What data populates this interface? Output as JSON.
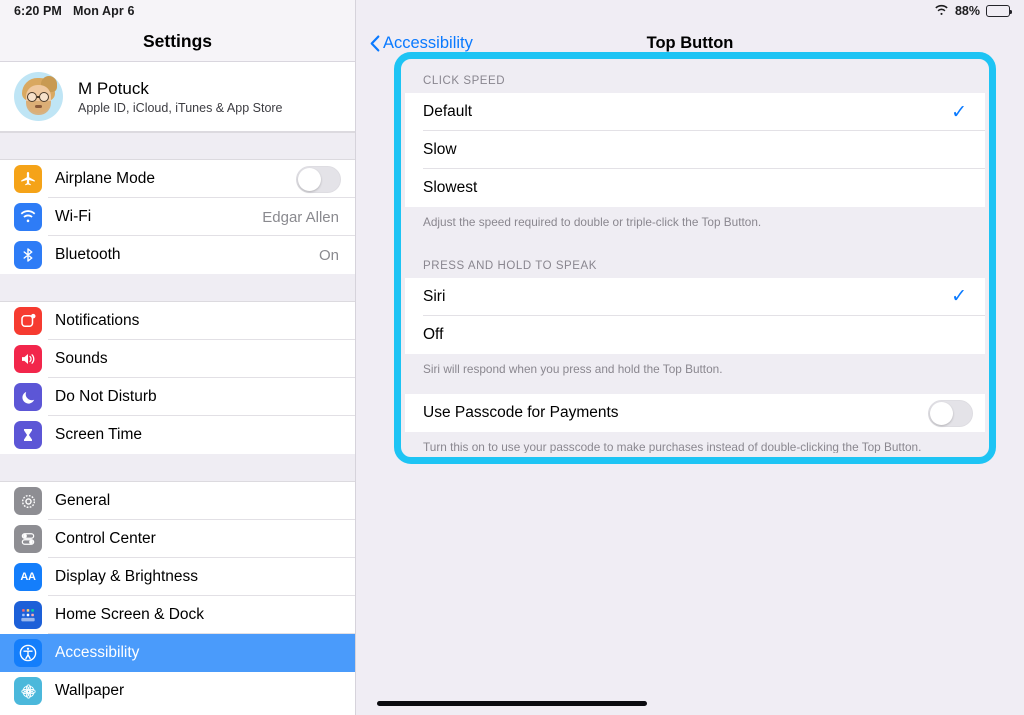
{
  "status_bar": {
    "time": "6:20 PM",
    "date": "Mon Apr 6",
    "wifi_icon": "wifi-icon",
    "battery_percent": "88%",
    "battery_level": 88
  },
  "sidebar": {
    "title": "Settings",
    "account": {
      "name": "M Potuck",
      "subtitle": "Apple ID, iCloud, iTunes & App Store",
      "avatar_icon": "memoji-avatar"
    },
    "groups": [
      {
        "items": [
          {
            "label": "Airplane Mode",
            "icon": "airplane-icon",
            "icon_class": "ic-airplane",
            "control": "toggle",
            "toggle_on": false,
            "detail": ""
          },
          {
            "label": "Wi-Fi",
            "icon": "wifi-icon",
            "icon_class": "ic-wifi",
            "control": "detail",
            "detail": "Edgar Allen"
          },
          {
            "label": "Bluetooth",
            "icon": "bluetooth-icon",
            "icon_class": "ic-bt",
            "control": "detail",
            "detail": "On"
          }
        ]
      },
      {
        "items": [
          {
            "label": "Notifications",
            "icon": "notifications-icon",
            "icon_class": "ic-notif",
            "control": "none",
            "detail": ""
          },
          {
            "label": "Sounds",
            "icon": "sounds-icon",
            "icon_class": "ic-sounds",
            "control": "none",
            "detail": ""
          },
          {
            "label": "Do Not Disturb",
            "icon": "moon-icon",
            "icon_class": "ic-dnd",
            "control": "none",
            "detail": ""
          },
          {
            "label": "Screen Time",
            "icon": "hourglass-icon",
            "icon_class": "ic-screen",
            "control": "none",
            "detail": ""
          }
        ]
      },
      {
        "items": [
          {
            "label": "General",
            "icon": "gear-icon",
            "icon_class": "ic-general",
            "control": "none",
            "detail": ""
          },
          {
            "label": "Control Center",
            "icon": "sliders-icon",
            "icon_class": "ic-control",
            "control": "none",
            "detail": ""
          },
          {
            "label": "Display & Brightness",
            "icon": "aa-text-icon",
            "icon_class": "ic-display",
            "control": "none",
            "detail": ""
          },
          {
            "label": "Home Screen & Dock",
            "icon": "home-screen-grid-icon",
            "icon_class": "ic-home",
            "control": "none",
            "detail": ""
          },
          {
            "label": "Accessibility",
            "icon": "accessibility-person-icon",
            "icon_class": "ic-access",
            "control": "none",
            "detail": "",
            "selected": true
          },
          {
            "label": "Wallpaper",
            "icon": "flower-icon",
            "icon_class": "ic-wallpaper",
            "control": "none",
            "detail": ""
          }
        ]
      }
    ]
  },
  "main": {
    "back_label": "Accessibility",
    "back_icon": "chevron-left-icon",
    "title": "Top Button",
    "highlight_color": "#1DC4F4",
    "accent_color": "#0A7AFF",
    "sections": [
      {
        "header": "CLICK SPEED",
        "options": [
          {
            "label": "Default",
            "checked": true
          },
          {
            "label": "Slow",
            "checked": false
          },
          {
            "label": "Slowest",
            "checked": false
          }
        ],
        "footnote": "Adjust the speed required to double or triple-click the Top Button."
      },
      {
        "header": "PRESS AND HOLD TO SPEAK",
        "options": [
          {
            "label": "Siri",
            "checked": true
          },
          {
            "label": "Off",
            "checked": false
          }
        ],
        "footnote": "Siri will respond when you press and hold the Top Button."
      }
    ],
    "passcode_row": {
      "label": "Use Passcode for Payments",
      "toggle_on": false,
      "footnote": "Turn this on to use your passcode to make purchases instead of double-clicking the Top Button."
    },
    "checkmark_glyph": "✓"
  }
}
